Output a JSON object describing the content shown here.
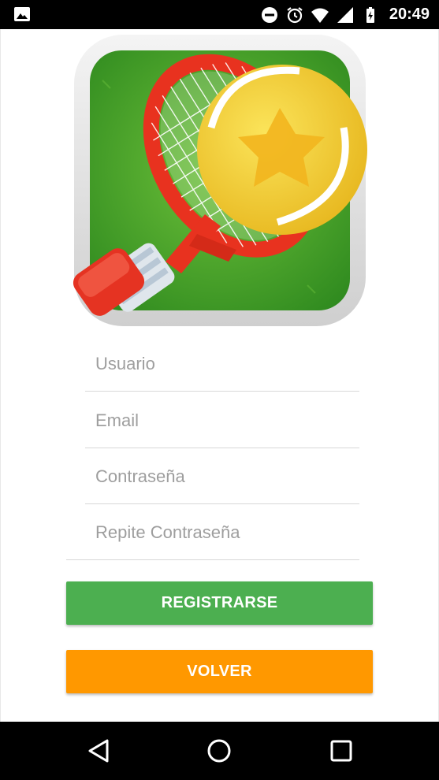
{
  "status_bar": {
    "time": "20:49",
    "icons": [
      "image-notification-icon",
      "do-not-disturb-icon",
      "alarm-icon",
      "wifi-icon",
      "signal-icon",
      "battery-charging-icon"
    ]
  },
  "logo": {
    "icon": "tennis-racket-ball-logo-icon"
  },
  "form": {
    "username_placeholder": "Usuario",
    "email_placeholder": "Email",
    "password_placeholder": "Contraseña",
    "repeat_password_placeholder": "Repite Contraseña"
  },
  "buttons": {
    "register_label": "REGISTRARSE",
    "back_label": "VOLVER"
  },
  "colors": {
    "register": "#4caf50",
    "back": "#ff9800"
  },
  "nav_bar": {
    "icons": [
      "back-triangle-icon",
      "home-circle-icon",
      "recents-square-icon"
    ]
  }
}
